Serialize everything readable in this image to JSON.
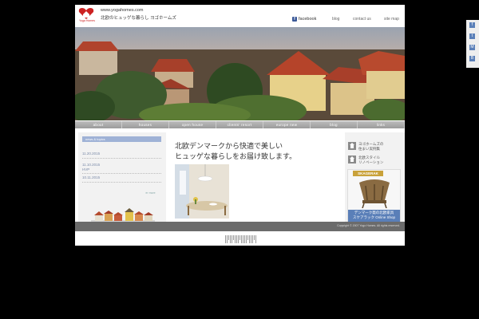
{
  "header": {
    "brand": "Yoga Homes",
    "url": "www.yogahomes.com",
    "tagline": "北欧のヒュッゲな暮らし ヨゴホームズ",
    "facebook": "facebook",
    "links": [
      "blog",
      "contact us",
      "site map"
    ]
  },
  "nav": [
    "about",
    "houses",
    "open house",
    "clients' resort",
    "europe new",
    "blog",
    "links"
  ],
  "news": {
    "title": "news & topics",
    "items": [
      {
        "date": "11.20.2015",
        "text": ""
      },
      {
        "date": "11.10.2015",
        "text": "HVP"
      },
      {
        "date": "10.11.2015",
        "text": ""
      }
    ],
    "more": "≫ more"
  },
  "main": {
    "headline": "北欧デンマークから快適で美しい\nヒュッゲな暮らしをお届け致します。"
  },
  "sidebar": {
    "links": [
      "ヨゴホームズの\n住まい実例集",
      "北欧スタイル\nリノベーション"
    ],
    "shop_logo": "SKAGERAK",
    "shop_banner": "デンマーク発の北欧家具\nスケアラック Online Shop"
  },
  "footer": {
    "copyright": "Copyright © 2007 Yogo Homes. All rights reserved."
  },
  "social": [
    "f",
    "t",
    "M",
    "B"
  ],
  "colors": {
    "accent": "#9fb2d6",
    "brand": "#cc2222",
    "footer": "#6b6b6b"
  }
}
